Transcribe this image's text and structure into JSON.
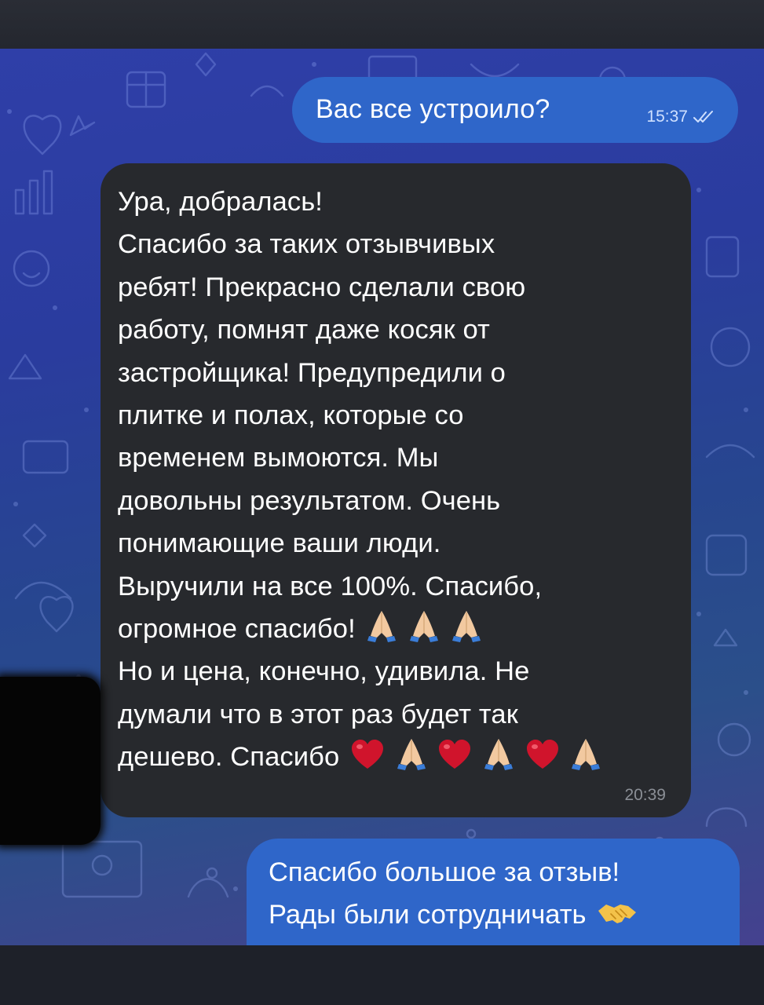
{
  "messages": {
    "outgoing_1": {
      "text": "Вас все устроило?",
      "time": "15:37"
    },
    "incoming": {
      "lines": [
        "Ура, добралась!",
        "Спасибо за таких отзывчивых",
        "ребят! Прекрасно сделали свою",
        "работу, помнят даже косяк от",
        "застройщика! Предупредили о",
        "плитке и полах, которые со",
        "временем вымоются. Мы",
        "довольны результатом. Очень",
        "понимающие ваши люди.",
        "Выручили на все 100%. Спасибо,",
        "огромное спасибо!",
        "Но и цена, конечно, удивила. Не",
        "думали что в этот раз будет так",
        "дешево. Спасибо"
      ],
      "time": "20:39"
    },
    "outgoing_2": {
      "line1": "Спасибо большое за отзыв!",
      "line2": "Рады были сотрудничать"
    }
  },
  "colors": {
    "outgoing_bubble": "#2f66c9",
    "incoming_bubble": "#27292d",
    "heart": "#d0142c",
    "prayer_hands": "#f2c9a0",
    "sleeve": "#3b7dd8"
  },
  "icons": [
    "double-check-icon",
    "pray-emoji-icon",
    "heart-emoji-icon",
    "handshake-emoji-icon"
  ]
}
